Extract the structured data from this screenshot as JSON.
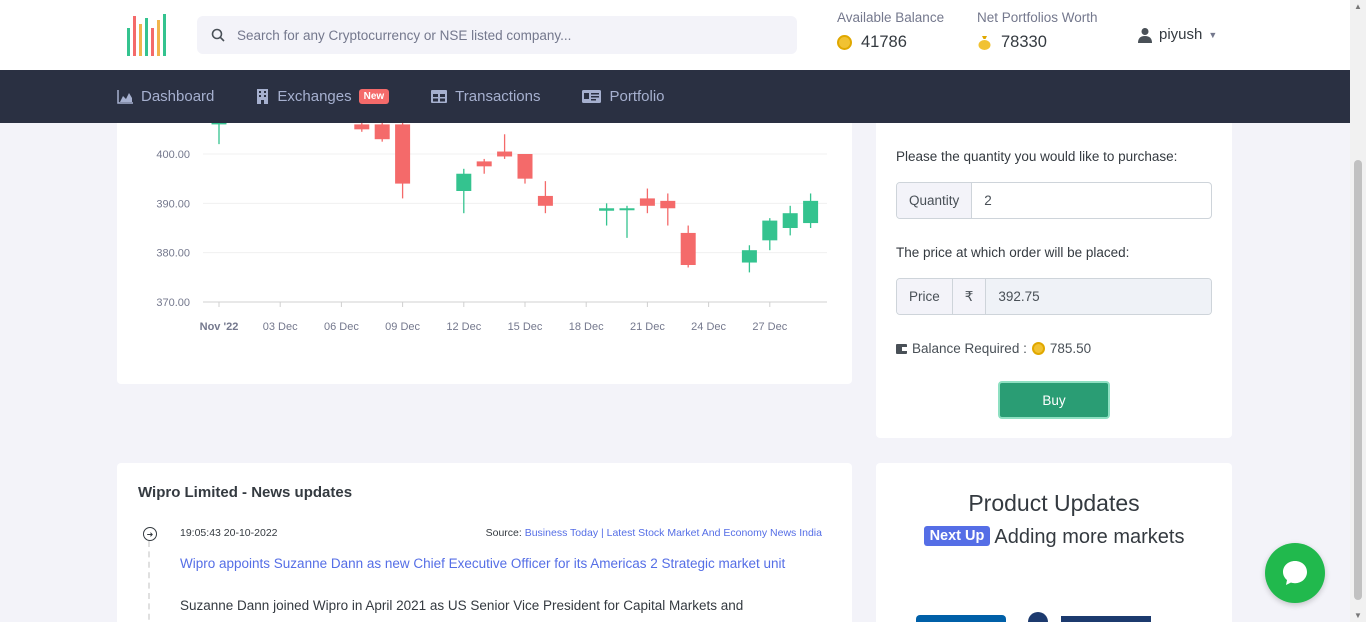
{
  "search": {
    "placeholder": "Search for any Cryptocurrency or NSE listed company..."
  },
  "balances": {
    "available_label": "Available Balance",
    "available_value": "41786",
    "net_label": "Net Portfolios Worth",
    "net_value": "78330"
  },
  "user": {
    "name": "piyush"
  },
  "nav": {
    "dashboard": "Dashboard",
    "exchanges": "Exchanges",
    "exchanges_badge": "New",
    "transactions": "Transactions",
    "portfolio": "Portfolio"
  },
  "chart_data": {
    "type": "candlestick",
    "y_ticks": [
      "400.00",
      "390.00",
      "380.00",
      "370.00"
    ],
    "x_ticks": [
      "Nov '22",
      "03 Dec",
      "06 Dec",
      "09 Dec",
      "12 Dec",
      "15 Dec",
      "18 Dec",
      "21 Dec",
      "24 Dec",
      "27 Dec"
    ],
    "ylim": [
      370,
      407
    ],
    "colors": {
      "up": "#34c38f",
      "down": "#f46a6a"
    },
    "candles": [
      {
        "x": 0,
        "open": 406,
        "close": 406.5,
        "high": 407,
        "low": 402
      },
      {
        "x": 7,
        "open": 406,
        "close": 405,
        "high": 407,
        "low": 404.5
      },
      {
        "x": 8,
        "open": 406,
        "close": 403,
        "high": 407,
        "low": 402.5
      },
      {
        "x": 9,
        "open": 406,
        "close": 394,
        "high": 406.5,
        "low": 391
      },
      {
        "x": 12,
        "open": 392.5,
        "close": 396,
        "high": 397,
        "low": 388
      },
      {
        "x": 13,
        "open": 398.5,
        "close": 397.5,
        "high": 399,
        "low": 396
      },
      {
        "x": 14,
        "open": 400.5,
        "close": 399.5,
        "high": 404,
        "low": 399
      },
      {
        "x": 15,
        "open": 400,
        "close": 395,
        "high": 400,
        "low": 394
      },
      {
        "x": 16,
        "open": 391.5,
        "close": 389.5,
        "high": 394.5,
        "low": 388
      },
      {
        "x": 19,
        "open": 388.5,
        "close": 389,
        "high": 390,
        "low": 385.5
      },
      {
        "x": 20,
        "open": 389,
        "close": 389,
        "high": 389.5,
        "low": 383
      },
      {
        "x": 21,
        "open": 391,
        "close": 389.5,
        "high": 393,
        "low": 388
      },
      {
        "x": 22,
        "open": 390.5,
        "close": 389,
        "high": 392,
        "low": 385.5
      },
      {
        "x": 23,
        "open": 384,
        "close": 377.5,
        "high": 385.5,
        "low": 377
      },
      {
        "x": 26,
        "open": 378,
        "close": 380.5,
        "high": 381.5,
        "low": 376
      },
      {
        "x": 27,
        "open": 382.5,
        "close": 386.5,
        "high": 387,
        "low": 380.5
      },
      {
        "x": 28,
        "open": 385,
        "close": 388,
        "high": 389.5,
        "low": 383.5
      },
      {
        "x": 29,
        "open": 386,
        "close": 390.5,
        "high": 392,
        "low": 385
      }
    ]
  },
  "order": {
    "quantity_prompt": "Please the quantity you would like to purchase:",
    "quantity_label": "Quantity",
    "quantity_value": "2",
    "price_prompt": "The price at which order will be placed:",
    "price_label": "Price",
    "currency_symbol": "₹",
    "price_value": "392.75",
    "balance_required_label": "Balance Required :",
    "balance_required_value": "785.50",
    "buy_label": "Buy"
  },
  "news": {
    "title": "Wipro Limited - News updates",
    "items": [
      {
        "time": "19:05:43 20-10-2022",
        "source_label": "Source:",
        "source_name": "Business Today | Latest Stock Market And Economy News India",
        "headline": "Wipro appoints Suzanne Dann as new Chief Executive Officer for its Americas 2 Strategic market unit",
        "body": "Suzanne Dann joined Wipro in April 2021 as US Senior Vice President for Capital Markets and"
      }
    ]
  },
  "product_updates": {
    "title": "Product Updates",
    "badge": "Next Up",
    "text": "Adding more markets"
  },
  "icons": {
    "search": "search-icon",
    "user": "user-icon",
    "chat": "chat-icon"
  }
}
